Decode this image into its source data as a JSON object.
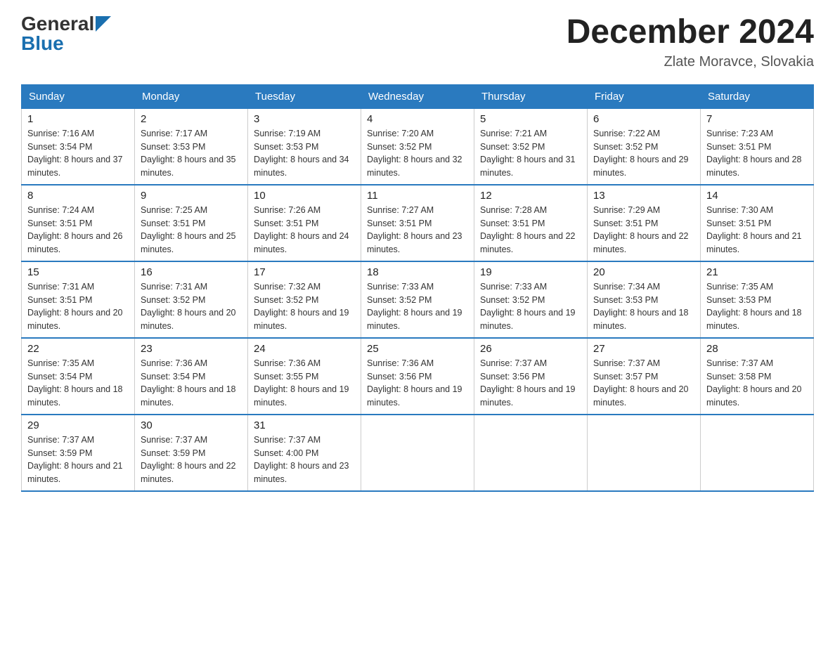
{
  "logo": {
    "general": "General",
    "blue": "Blue"
  },
  "title": "December 2024",
  "location": "Zlate Moravce, Slovakia",
  "days_of_week": [
    "Sunday",
    "Monday",
    "Tuesday",
    "Wednesday",
    "Thursday",
    "Friday",
    "Saturday"
  ],
  "weeks": [
    [
      {
        "day": "1",
        "sunrise": "7:16 AM",
        "sunset": "3:54 PM",
        "daylight": "8 hours and 37 minutes."
      },
      {
        "day": "2",
        "sunrise": "7:17 AM",
        "sunset": "3:53 PM",
        "daylight": "8 hours and 35 minutes."
      },
      {
        "day": "3",
        "sunrise": "7:19 AM",
        "sunset": "3:53 PM",
        "daylight": "8 hours and 34 minutes."
      },
      {
        "day": "4",
        "sunrise": "7:20 AM",
        "sunset": "3:52 PM",
        "daylight": "8 hours and 32 minutes."
      },
      {
        "day": "5",
        "sunrise": "7:21 AM",
        "sunset": "3:52 PM",
        "daylight": "8 hours and 31 minutes."
      },
      {
        "day": "6",
        "sunrise": "7:22 AM",
        "sunset": "3:52 PM",
        "daylight": "8 hours and 29 minutes."
      },
      {
        "day": "7",
        "sunrise": "7:23 AM",
        "sunset": "3:51 PM",
        "daylight": "8 hours and 28 minutes."
      }
    ],
    [
      {
        "day": "8",
        "sunrise": "7:24 AM",
        "sunset": "3:51 PM",
        "daylight": "8 hours and 26 minutes."
      },
      {
        "day": "9",
        "sunrise": "7:25 AM",
        "sunset": "3:51 PM",
        "daylight": "8 hours and 25 minutes."
      },
      {
        "day": "10",
        "sunrise": "7:26 AM",
        "sunset": "3:51 PM",
        "daylight": "8 hours and 24 minutes."
      },
      {
        "day": "11",
        "sunrise": "7:27 AM",
        "sunset": "3:51 PM",
        "daylight": "8 hours and 23 minutes."
      },
      {
        "day": "12",
        "sunrise": "7:28 AM",
        "sunset": "3:51 PM",
        "daylight": "8 hours and 22 minutes."
      },
      {
        "day": "13",
        "sunrise": "7:29 AM",
        "sunset": "3:51 PM",
        "daylight": "8 hours and 22 minutes."
      },
      {
        "day": "14",
        "sunrise": "7:30 AM",
        "sunset": "3:51 PM",
        "daylight": "8 hours and 21 minutes."
      }
    ],
    [
      {
        "day": "15",
        "sunrise": "7:31 AM",
        "sunset": "3:51 PM",
        "daylight": "8 hours and 20 minutes."
      },
      {
        "day": "16",
        "sunrise": "7:31 AM",
        "sunset": "3:52 PM",
        "daylight": "8 hours and 20 minutes."
      },
      {
        "day": "17",
        "sunrise": "7:32 AM",
        "sunset": "3:52 PM",
        "daylight": "8 hours and 19 minutes."
      },
      {
        "day": "18",
        "sunrise": "7:33 AM",
        "sunset": "3:52 PM",
        "daylight": "8 hours and 19 minutes."
      },
      {
        "day": "19",
        "sunrise": "7:33 AM",
        "sunset": "3:52 PM",
        "daylight": "8 hours and 19 minutes."
      },
      {
        "day": "20",
        "sunrise": "7:34 AM",
        "sunset": "3:53 PM",
        "daylight": "8 hours and 18 minutes."
      },
      {
        "day": "21",
        "sunrise": "7:35 AM",
        "sunset": "3:53 PM",
        "daylight": "8 hours and 18 minutes."
      }
    ],
    [
      {
        "day": "22",
        "sunrise": "7:35 AM",
        "sunset": "3:54 PM",
        "daylight": "8 hours and 18 minutes."
      },
      {
        "day": "23",
        "sunrise": "7:36 AM",
        "sunset": "3:54 PM",
        "daylight": "8 hours and 18 minutes."
      },
      {
        "day": "24",
        "sunrise": "7:36 AM",
        "sunset": "3:55 PM",
        "daylight": "8 hours and 19 minutes."
      },
      {
        "day": "25",
        "sunrise": "7:36 AM",
        "sunset": "3:56 PM",
        "daylight": "8 hours and 19 minutes."
      },
      {
        "day": "26",
        "sunrise": "7:37 AM",
        "sunset": "3:56 PM",
        "daylight": "8 hours and 19 minutes."
      },
      {
        "day": "27",
        "sunrise": "7:37 AM",
        "sunset": "3:57 PM",
        "daylight": "8 hours and 20 minutes."
      },
      {
        "day": "28",
        "sunrise": "7:37 AM",
        "sunset": "3:58 PM",
        "daylight": "8 hours and 20 minutes."
      }
    ],
    [
      {
        "day": "29",
        "sunrise": "7:37 AM",
        "sunset": "3:59 PM",
        "daylight": "8 hours and 21 minutes."
      },
      {
        "day": "30",
        "sunrise": "7:37 AM",
        "sunset": "3:59 PM",
        "daylight": "8 hours and 22 minutes."
      },
      {
        "day": "31",
        "sunrise": "7:37 AM",
        "sunset": "4:00 PM",
        "daylight": "8 hours and 23 minutes."
      },
      null,
      null,
      null,
      null
    ]
  ]
}
